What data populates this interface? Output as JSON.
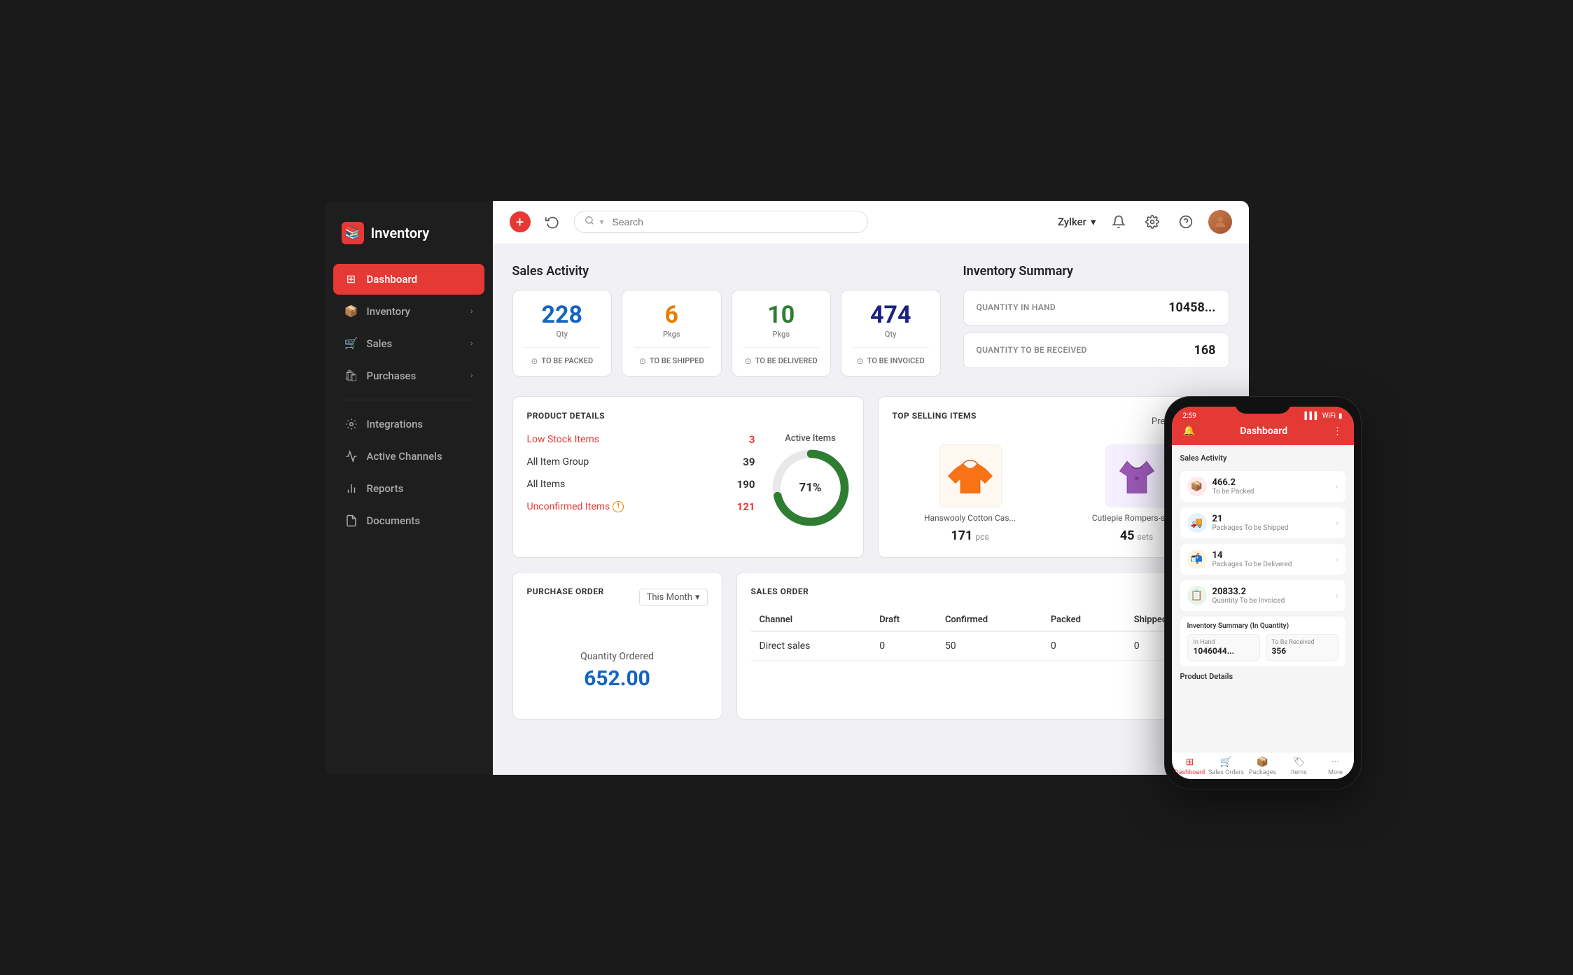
{
  "app": {
    "logo_icon": "📚",
    "logo_text": "Inventory"
  },
  "sidebar": {
    "items": [
      {
        "id": "dashboard",
        "label": "Dashboard",
        "icon": "⊞",
        "active": true,
        "has_arrow": false
      },
      {
        "id": "inventory",
        "label": "Inventory",
        "icon": "📦",
        "active": false,
        "has_arrow": true
      },
      {
        "id": "sales",
        "label": "Sales",
        "icon": "🛒",
        "active": false,
        "has_arrow": true
      },
      {
        "id": "purchases",
        "label": "Purchases",
        "icon": "🛍",
        "active": false,
        "has_arrow": true
      },
      {
        "id": "integrations",
        "label": "Integrations",
        "icon": "⚙",
        "active": false,
        "has_arrow": false
      },
      {
        "id": "active-channels",
        "label": "Active Channels",
        "icon": "📡",
        "active": false,
        "has_arrow": false
      },
      {
        "id": "reports",
        "label": "Reports",
        "icon": "📊",
        "active": false,
        "has_arrow": false
      },
      {
        "id": "documents",
        "label": "Documents",
        "icon": "📁",
        "active": false,
        "has_arrow": false
      }
    ]
  },
  "topbar": {
    "search_placeholder": "Search",
    "org_name": "Zylker",
    "add_btn_label": "+",
    "history_icon": "↺",
    "bell_icon": "🔔",
    "settings_icon": "⚙",
    "help_icon": "?",
    "chevron_icon": "▾"
  },
  "sales_activity": {
    "title": "Sales Activity",
    "cards": [
      {
        "number": "228",
        "unit_label": "Qty",
        "footer": "TO BE PACKED",
        "color": "blue"
      },
      {
        "number": "6",
        "unit_label": "Pkgs",
        "footer": "TO BE SHIPPED",
        "color": "orange"
      },
      {
        "number": "10",
        "unit_label": "Pkgs",
        "footer": "TO BE DELIVERED",
        "color": "green"
      },
      {
        "number": "474",
        "unit_label": "Qty",
        "footer": "TO BE INVOICED",
        "color": "dark-blue"
      }
    ]
  },
  "inventory_summary": {
    "title": "Inventory Summary",
    "items": [
      {
        "label": "QUANTITY IN HAND",
        "value": "10458..."
      },
      {
        "label": "QUANTITY TO BE RECEIVED",
        "value": "168"
      }
    ]
  },
  "product_details": {
    "title": "PRODUCT DETAILS",
    "stats": [
      {
        "label": "Low Stock Items",
        "value": "3",
        "red": true
      },
      {
        "label": "All Item Group",
        "value": "39",
        "red": false
      },
      {
        "label": "All Items",
        "value": "190",
        "red": false
      },
      {
        "label": "Unconfirmed Items",
        "value": "121",
        "red": true,
        "warning": true
      }
    ],
    "active_items_label": "Active Items",
    "active_items_pct": "71%",
    "donut_pct": 71
  },
  "top_selling": {
    "title": "TOP SELLING ITEMS",
    "filter": "Previous Year",
    "items": [
      {
        "name": "Hanswooly Cotton Cas...",
        "qty": "171",
        "unit": "pcs",
        "color": "#f97316"
      },
      {
        "name": "Cutiepie Rompers-spo...",
        "qty": "45",
        "unit": "sets",
        "color": "#9b59b6"
      }
    ]
  },
  "purchase_order": {
    "title": "PURCHASE ORDER",
    "filter": "This Month",
    "qty_label": "Quantity Ordered",
    "qty_value": "652.00"
  },
  "sales_order": {
    "title": "SALES ORDER",
    "columns": [
      "Channel",
      "Draft",
      "Confirmed",
      "Packed",
      "Shipped"
    ],
    "rows": [
      {
        "channel": "Direct sales",
        "draft": "0",
        "confirmed": "50",
        "packed": "0",
        "shipped": "0"
      }
    ]
  },
  "phone": {
    "time": "2:59",
    "header_title": "Dashboard",
    "sections": {
      "sales_activity_label": "Sales Activity",
      "activity_items": [
        {
          "value": "466.2",
          "desc": "To be Packed",
          "color": "red"
        },
        {
          "value": "21",
          "desc": "Packages To be Shipped",
          "color": "blue"
        },
        {
          "value": "14",
          "desc": "Packages To be Delivered",
          "color": "orange"
        },
        {
          "value": "20833.2",
          "desc": "Quantity To be Invoiced",
          "color": "green"
        }
      ],
      "inventory_summary_label": "Inventory Summary (In Quantity)",
      "inventory_items": [
        {
          "label": "In Hand",
          "value": "1046044..."
        },
        {
          "label": "To Be Received",
          "value": "356"
        }
      ],
      "product_details_label": "Product Details"
    },
    "bottom_nav": [
      {
        "label": "Dashboard",
        "icon": "⊞",
        "active": true
      },
      {
        "label": "Sales Orders",
        "icon": "🛒",
        "active": false
      },
      {
        "label": "Packages",
        "icon": "📦",
        "active": false
      },
      {
        "label": "Items",
        "icon": "🏷",
        "active": false
      },
      {
        "label": "More",
        "icon": "•••",
        "active": false
      }
    ]
  }
}
